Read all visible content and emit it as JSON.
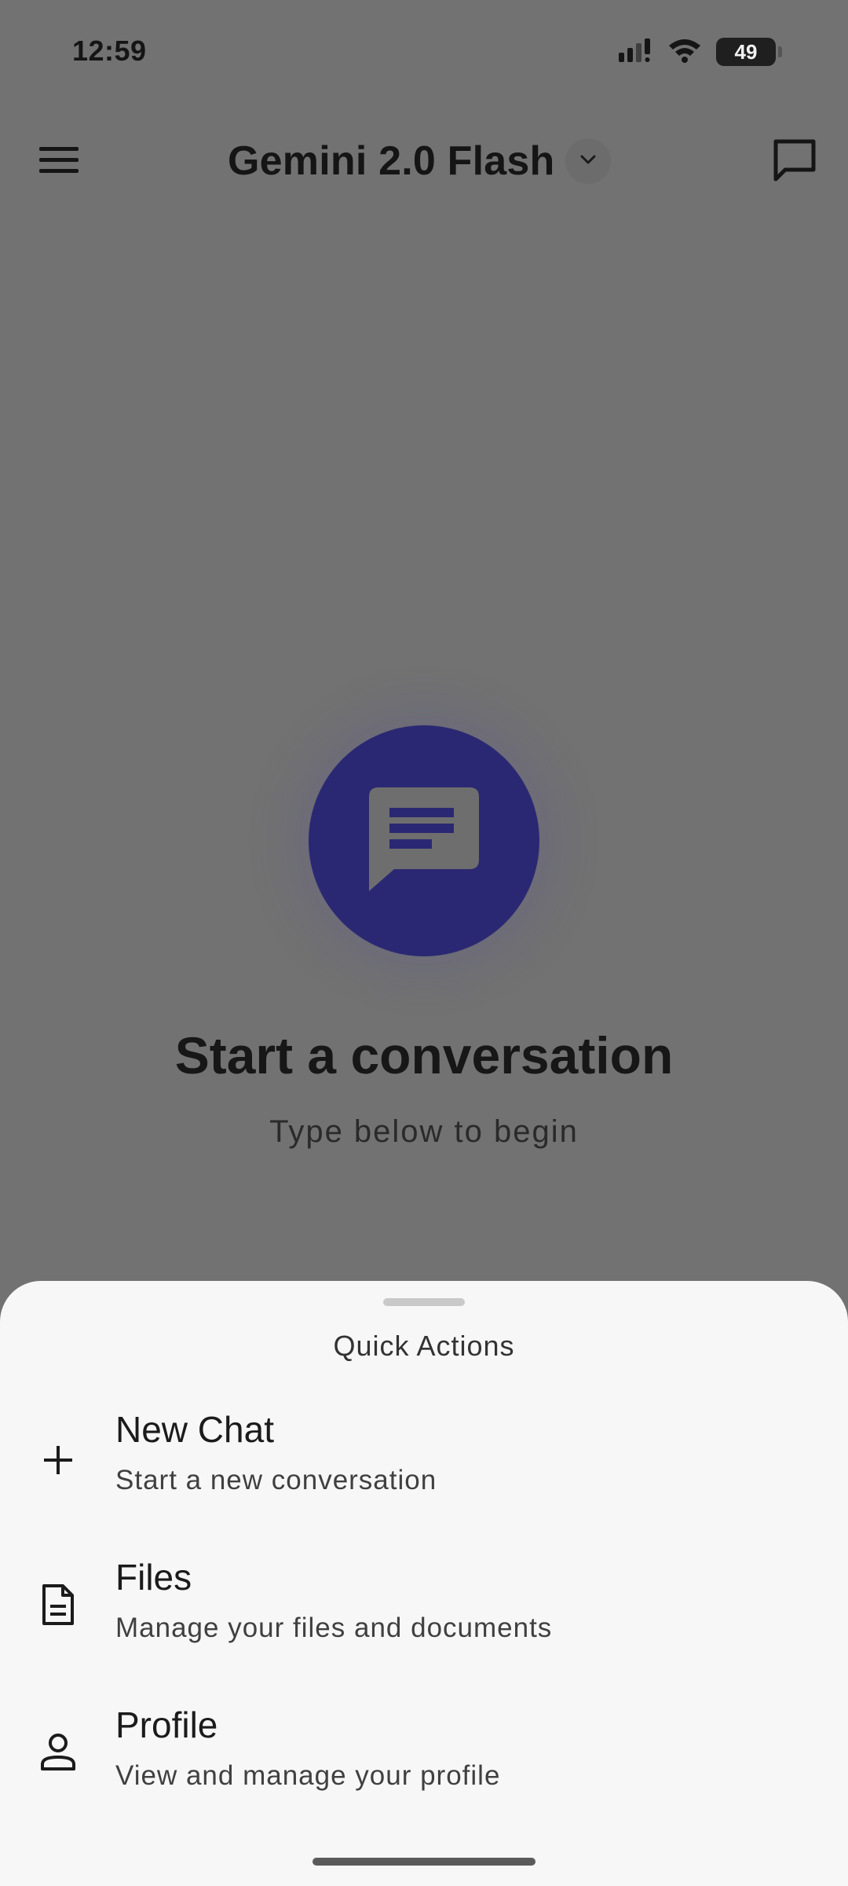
{
  "status_bar": {
    "time": "12:59",
    "battery": "49"
  },
  "app_bar": {
    "model_name": "Gemini 2.0 Flash"
  },
  "empty_state": {
    "title": "Start a conversation",
    "subtitle": "Type below to begin"
  },
  "quick_actions": {
    "title": "Quick Actions",
    "items": [
      {
        "icon": "plus-icon",
        "label": "New Chat",
        "description": "Start a new conversation"
      },
      {
        "icon": "file-icon",
        "label": "Files",
        "description": "Manage your files and documents"
      },
      {
        "icon": "person-icon",
        "label": "Profile",
        "description": "View and manage your profile"
      }
    ]
  },
  "colors": {
    "accent": "#2b2873",
    "scrim": "#727272",
    "sheet": "#f7f7f7"
  }
}
